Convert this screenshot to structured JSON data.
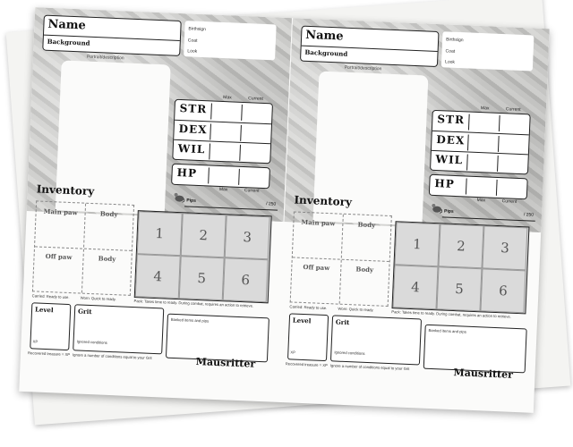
{
  "sheet": {
    "name_label": "Name",
    "background_label": "Background",
    "birthsign_label": "Birthsign",
    "coat_label": "Coat",
    "look_label": "Look",
    "portrait_label": "Portrait/description",
    "max_label": "Max",
    "current_label": "Current",
    "stats": [
      "STR",
      "DEX",
      "WIL"
    ],
    "hp_label": "HP",
    "inventory_title": "Inventory",
    "pips_label": "Pips",
    "pips_max": "/ 250",
    "main_paw": "Main paw",
    "off_paw": "Off paw",
    "body": "Body",
    "pack_slots": [
      "1",
      "2",
      "3",
      "4",
      "5",
      "6"
    ],
    "carried_note": "Carried: Ready to use.",
    "worn_note": "Worn: Quick to ready.",
    "pack_note": "Pack: Takes time to ready. During combat, requires an action to retrieve.",
    "level_label": "Level",
    "xp_label": "XP",
    "recovered_note": "Recovered treasure = XP",
    "grit_label": "Grit",
    "ignored_label": "Ignored conditions",
    "grit_note": "Ignore a number of conditions equal to your Grit",
    "banked_label": "Banked items and pips",
    "brand": "Mausritter"
  },
  "colors": {
    "ink": "#111111",
    "paper": "#fbfbfa",
    "stone": "#c8c8c6",
    "pack": "#dadada"
  }
}
